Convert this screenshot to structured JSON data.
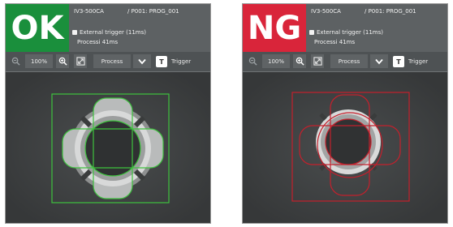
{
  "panels": [
    {
      "badge": "OK",
      "badge_color": "#1a8f3c",
      "device": "IV3-500CA",
      "program": "/ P001: PROG_001",
      "trigger_mode": "External trigger (11ms)",
      "process_time": "Processi 41ms",
      "toolbar": {
        "zoom_level": "100%",
        "process_label": "Process",
        "trigger_label": "Trigger",
        "trigger_icon": "T"
      },
      "outline_color": "#3ec23e"
    },
    {
      "badge": "NG",
      "badge_color": "#d9253a",
      "device": "IV3-500CA",
      "program": "/ P001: PROG_001",
      "trigger_mode": "External trigger (11ms)",
      "process_time": "Processi 41ms",
      "toolbar": {
        "zoom_level": "100%",
        "process_label": "Process",
        "trigger_label": "Trigger",
        "trigger_icon": "T"
      },
      "outline_color": "#c4202c"
    }
  ]
}
